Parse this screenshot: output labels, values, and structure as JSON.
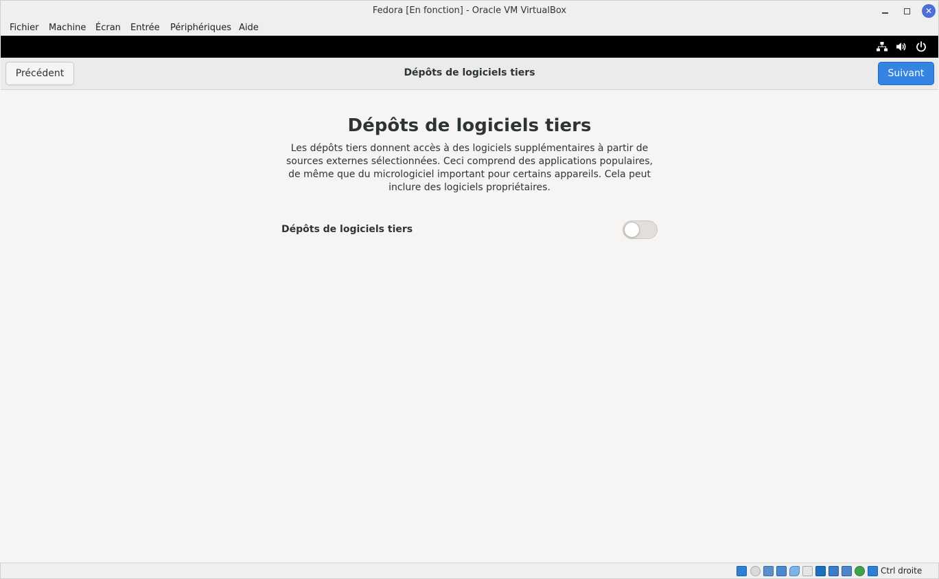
{
  "window": {
    "title": "Fedora [En fonction] - Oracle VM VirtualBox"
  },
  "menubar": {
    "items": [
      "Fichier",
      "Machine",
      "Écran",
      "Entrée",
      "Périphériques",
      "Aide"
    ]
  },
  "header": {
    "back_label": "Précédent",
    "title": "Dépôts de logiciels tiers",
    "next_label": "Suivant"
  },
  "main": {
    "heading": "Dépôts de logiciels tiers",
    "description": "Les dépôts tiers donnent accès à des logiciels supplémentaires à partir de sources externes sélectionnées. Ceci comprend des applications populaires, de même que du micrologiciel important pour certains appareils. Cela peut inclure des logiciels propriétaires.",
    "toggle_label": "Dépôts de logiciels tiers",
    "toggle_on": false
  },
  "statusbar": {
    "host_key": "Ctrl droite"
  },
  "colors": {
    "accent": "#3584e4",
    "close_button": "#4c6fd6"
  }
}
